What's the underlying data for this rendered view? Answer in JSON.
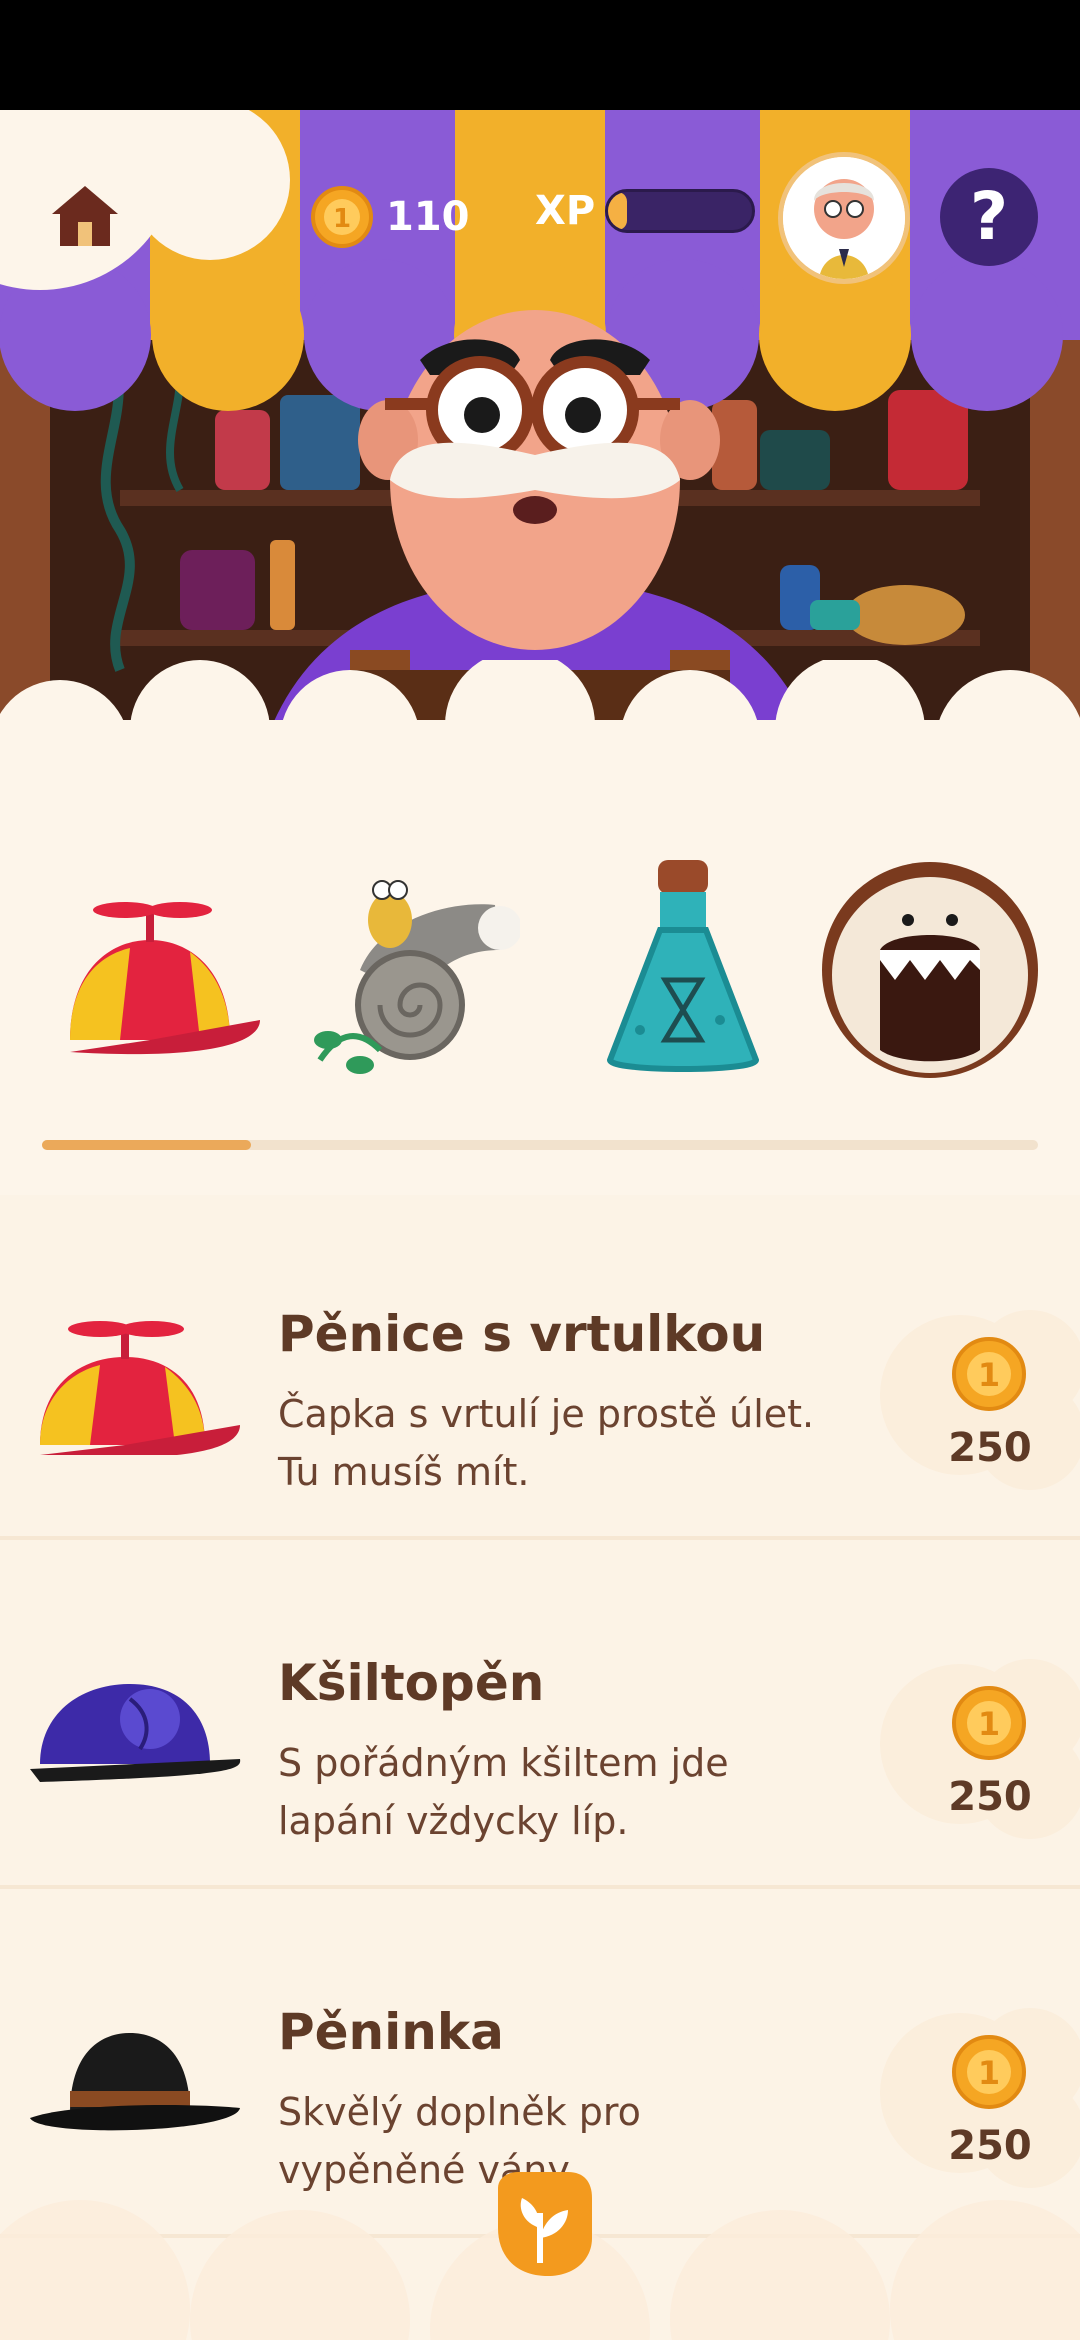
{
  "header": {
    "coins": "110",
    "xp_label": "XP",
    "xp_progress": 0.13,
    "help_label": "?"
  },
  "categories": [
    {
      "icon": "propeller-cap-icon"
    },
    {
      "icon": "snail-shell-horn-icon"
    },
    {
      "icon": "potion-bottle-icon"
    },
    {
      "icon": "foam-monster-icon"
    }
  ],
  "category_progress": 0.21,
  "products": [
    {
      "icon": "propeller-cap-icon",
      "title": "Pěnice s vrtulkou",
      "description": "Čapka s vrtulí je prostě úlet. Tu musíš mít.",
      "price": "250"
    },
    {
      "icon": "baseball-cap-icon",
      "title": "Kšiltopěn",
      "description": "S pořádným kšiltem jde lapání vždycky líp.",
      "price": "250"
    },
    {
      "icon": "bowler-hat-icon",
      "title": "Pěninka",
      "description": "Skvělý doplněk pro vypěněné vány",
      "price": "250"
    }
  ],
  "colors": {
    "background": "#fdf5ea",
    "awning_purple": "#8a5bd6",
    "awning_yellow": "#f2b02a",
    "text_brown": "#5e3a26",
    "accent_orange": "#eba95a",
    "logo_orange": "#f39a1e"
  }
}
